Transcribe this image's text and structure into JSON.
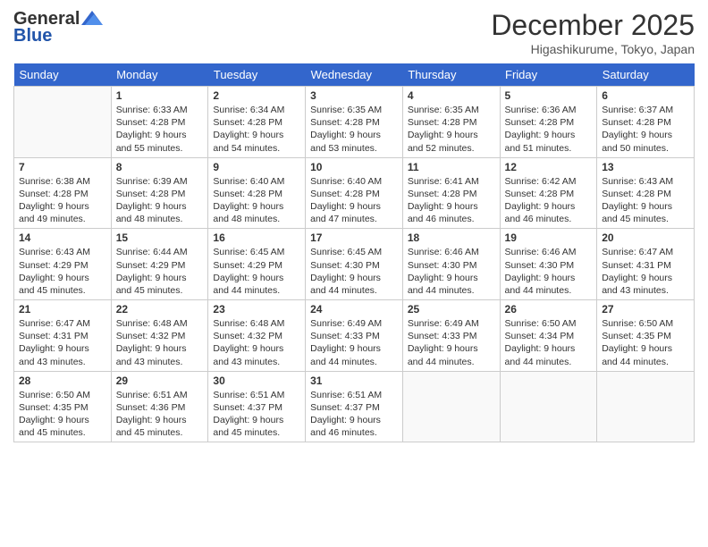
{
  "header": {
    "logo_general": "General",
    "logo_blue": "Blue",
    "month_title": "December 2025",
    "location": "Higashikurume, Tokyo, Japan"
  },
  "weekdays": [
    "Sunday",
    "Monday",
    "Tuesday",
    "Wednesday",
    "Thursday",
    "Friday",
    "Saturday"
  ],
  "weeks": [
    [
      {
        "day": "",
        "info": ""
      },
      {
        "day": "1",
        "info": "Sunrise: 6:33 AM\nSunset: 4:28 PM\nDaylight: 9 hours\nand 55 minutes."
      },
      {
        "day": "2",
        "info": "Sunrise: 6:34 AM\nSunset: 4:28 PM\nDaylight: 9 hours\nand 54 minutes."
      },
      {
        "day": "3",
        "info": "Sunrise: 6:35 AM\nSunset: 4:28 PM\nDaylight: 9 hours\nand 53 minutes."
      },
      {
        "day": "4",
        "info": "Sunrise: 6:35 AM\nSunset: 4:28 PM\nDaylight: 9 hours\nand 52 minutes."
      },
      {
        "day": "5",
        "info": "Sunrise: 6:36 AM\nSunset: 4:28 PM\nDaylight: 9 hours\nand 51 minutes."
      },
      {
        "day": "6",
        "info": "Sunrise: 6:37 AM\nSunset: 4:28 PM\nDaylight: 9 hours\nand 50 minutes."
      }
    ],
    [
      {
        "day": "7",
        "info": "Sunrise: 6:38 AM\nSunset: 4:28 PM\nDaylight: 9 hours\nand 49 minutes."
      },
      {
        "day": "8",
        "info": "Sunrise: 6:39 AM\nSunset: 4:28 PM\nDaylight: 9 hours\nand 48 minutes."
      },
      {
        "day": "9",
        "info": "Sunrise: 6:40 AM\nSunset: 4:28 PM\nDaylight: 9 hours\nand 48 minutes."
      },
      {
        "day": "10",
        "info": "Sunrise: 6:40 AM\nSunset: 4:28 PM\nDaylight: 9 hours\nand 47 minutes."
      },
      {
        "day": "11",
        "info": "Sunrise: 6:41 AM\nSunset: 4:28 PM\nDaylight: 9 hours\nand 46 minutes."
      },
      {
        "day": "12",
        "info": "Sunrise: 6:42 AM\nSunset: 4:28 PM\nDaylight: 9 hours\nand 46 minutes."
      },
      {
        "day": "13",
        "info": "Sunrise: 6:43 AM\nSunset: 4:28 PM\nDaylight: 9 hours\nand 45 minutes."
      }
    ],
    [
      {
        "day": "14",
        "info": "Sunrise: 6:43 AM\nSunset: 4:29 PM\nDaylight: 9 hours\nand 45 minutes."
      },
      {
        "day": "15",
        "info": "Sunrise: 6:44 AM\nSunset: 4:29 PM\nDaylight: 9 hours\nand 45 minutes."
      },
      {
        "day": "16",
        "info": "Sunrise: 6:45 AM\nSunset: 4:29 PM\nDaylight: 9 hours\nand 44 minutes."
      },
      {
        "day": "17",
        "info": "Sunrise: 6:45 AM\nSunset: 4:30 PM\nDaylight: 9 hours\nand 44 minutes."
      },
      {
        "day": "18",
        "info": "Sunrise: 6:46 AM\nSunset: 4:30 PM\nDaylight: 9 hours\nand 44 minutes."
      },
      {
        "day": "19",
        "info": "Sunrise: 6:46 AM\nSunset: 4:30 PM\nDaylight: 9 hours\nand 44 minutes."
      },
      {
        "day": "20",
        "info": "Sunrise: 6:47 AM\nSunset: 4:31 PM\nDaylight: 9 hours\nand 43 minutes."
      }
    ],
    [
      {
        "day": "21",
        "info": "Sunrise: 6:47 AM\nSunset: 4:31 PM\nDaylight: 9 hours\nand 43 minutes."
      },
      {
        "day": "22",
        "info": "Sunrise: 6:48 AM\nSunset: 4:32 PM\nDaylight: 9 hours\nand 43 minutes."
      },
      {
        "day": "23",
        "info": "Sunrise: 6:48 AM\nSunset: 4:32 PM\nDaylight: 9 hours\nand 43 minutes."
      },
      {
        "day": "24",
        "info": "Sunrise: 6:49 AM\nSunset: 4:33 PM\nDaylight: 9 hours\nand 44 minutes."
      },
      {
        "day": "25",
        "info": "Sunrise: 6:49 AM\nSunset: 4:33 PM\nDaylight: 9 hours\nand 44 minutes."
      },
      {
        "day": "26",
        "info": "Sunrise: 6:50 AM\nSunset: 4:34 PM\nDaylight: 9 hours\nand 44 minutes."
      },
      {
        "day": "27",
        "info": "Sunrise: 6:50 AM\nSunset: 4:35 PM\nDaylight: 9 hours\nand 44 minutes."
      }
    ],
    [
      {
        "day": "28",
        "info": "Sunrise: 6:50 AM\nSunset: 4:35 PM\nDaylight: 9 hours\nand 45 minutes."
      },
      {
        "day": "29",
        "info": "Sunrise: 6:51 AM\nSunset: 4:36 PM\nDaylight: 9 hours\nand 45 minutes."
      },
      {
        "day": "30",
        "info": "Sunrise: 6:51 AM\nSunset: 4:37 PM\nDaylight: 9 hours\nand 45 minutes."
      },
      {
        "day": "31",
        "info": "Sunrise: 6:51 AM\nSunset: 4:37 PM\nDaylight: 9 hours\nand 46 minutes."
      },
      {
        "day": "",
        "info": ""
      },
      {
        "day": "",
        "info": ""
      },
      {
        "day": "",
        "info": ""
      }
    ]
  ]
}
